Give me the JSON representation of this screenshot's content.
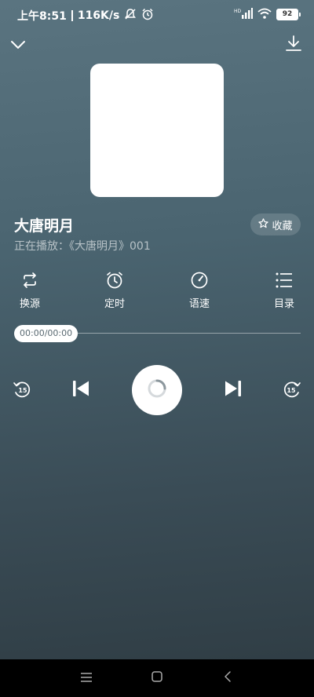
{
  "status_bar": {
    "time": "上午8:51",
    "net_speed": "116K/s",
    "battery": "92",
    "signal_label": "HD",
    "icons": [
      "mute-icon",
      "alarm-icon",
      "signal-icon",
      "wifi-icon",
      "battery-icon"
    ]
  },
  "header": {
    "collapse_icon": "chevron-down-icon",
    "download_icon": "download-icon"
  },
  "track": {
    "title": "大唐明月",
    "now_playing": "正在播放：《大唐明月》001",
    "favorite_label": "收藏"
  },
  "functions": [
    {
      "label": "换源",
      "icon": "switch-source-icon"
    },
    {
      "label": "定时",
      "icon": "timer-icon"
    },
    {
      "label": "语速",
      "icon": "speed-icon"
    },
    {
      "label": "目录",
      "icon": "list-icon"
    }
  ],
  "progress": {
    "time": "00:00/00:00",
    "fraction": 0
  },
  "controls": {
    "rewind_seconds": "15",
    "forward_seconds": "15"
  },
  "colors": {
    "accent": "#ffffff",
    "background_top": "#5a7480",
    "background_bottom": "#2e3b42"
  }
}
